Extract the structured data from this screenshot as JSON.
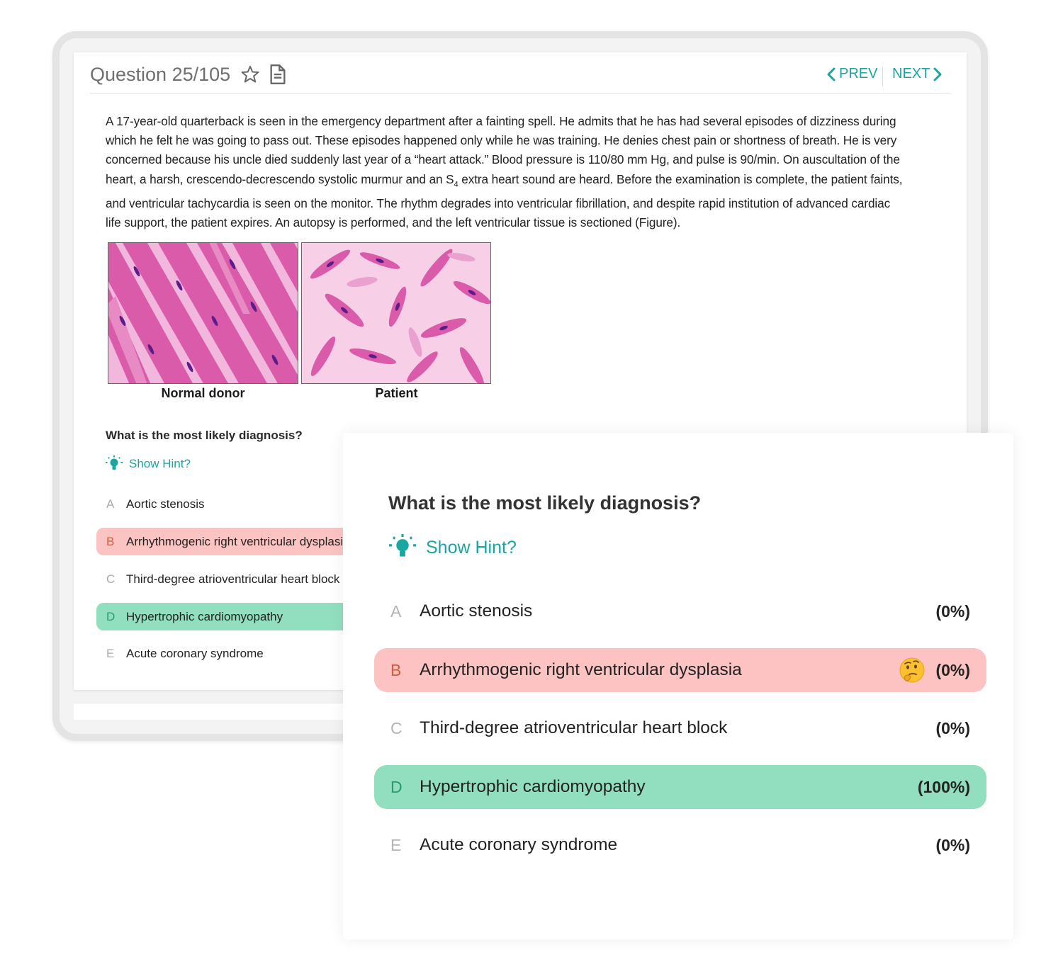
{
  "header": {
    "question_counter": "Question 25/105",
    "prev_label": "PREV",
    "next_label": "NEXT",
    "icons": [
      "star-icon",
      "document-icon",
      "chevron-left-icon",
      "chevron-right-icon"
    ]
  },
  "stem": {
    "line1": "A 17-year-old quarterback is seen in the emergency department after a fainting spell. He admits that he has had several episodes of dizziness during",
    "line2": "which he felt he was going to pass out. These episodes happened only while he was training. He denies chest pain or shortness of breath. He is very",
    "line3": "concerned because his uncle died suddenly last year of a “heart attack.” Blood pressure is 110/80 mm Hg, and pulse is 90/min. On auscultation of the",
    "line4_a": "heart, a harsh, crescendo-decrescendo systolic murmur and an S",
    "line4_sub": "4",
    "line4_b": " extra heart sound are heard. Before the examination is complete, the patient faints,",
    "line5": "and ventricular tachycardia is seen on the monitor. The rhythm degrades into ventricular fibrillation, and despite rapid institution of advanced cardiac",
    "line6": "life support, the patient expires. An autopsy is performed, and the left ventricular tissue is sectioned (Figure)."
  },
  "figure": {
    "left_label": "Normal donor",
    "right_label": "Patient"
  },
  "question": {
    "prompt": "What is the most likely diagnosis?",
    "hint_label": "Show Hint?"
  },
  "options": [
    {
      "letter": "A",
      "text": "Aortic stenosis",
      "percent": "(0%)",
      "state": "neutral"
    },
    {
      "letter": "B",
      "text": "Arrhythmogenic right ventricular dysplasia",
      "percent": "(0%)",
      "state": "wrong"
    },
    {
      "letter": "C",
      "text": "Third-degree atrioventricular heart block",
      "percent": "(0%)",
      "state": "neutral"
    },
    {
      "letter": "D",
      "text": "Hypertrophic cardiomyopathy",
      "percent": "(100%)",
      "state": "correct"
    },
    {
      "letter": "E",
      "text": "Acute coronary syndrome",
      "percent": "(0%)",
      "state": "neutral"
    }
  ],
  "colors": {
    "accent_teal": "#1aa6a0",
    "wrong_bg": "#fdc2c2",
    "correct_bg": "#91dfbf"
  }
}
